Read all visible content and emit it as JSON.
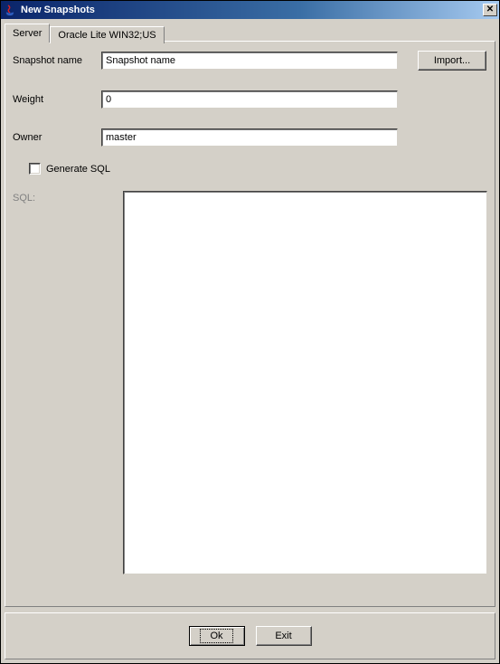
{
  "window": {
    "title": "New Snapshots"
  },
  "tabs": {
    "server": "Server",
    "oracle": "Oracle Lite WIN32;US"
  },
  "form": {
    "snapshot_label": "Snapshot name",
    "snapshot_value": "Snapshot name",
    "weight_label": "Weight",
    "weight_value": "0",
    "owner_label": "Owner",
    "owner_value": "master",
    "generate_sql_label": "Generate SQL",
    "sql_label": "SQL:",
    "sql_value": ""
  },
  "buttons": {
    "import": "Import...",
    "ok": "Ok",
    "exit": "Exit"
  }
}
